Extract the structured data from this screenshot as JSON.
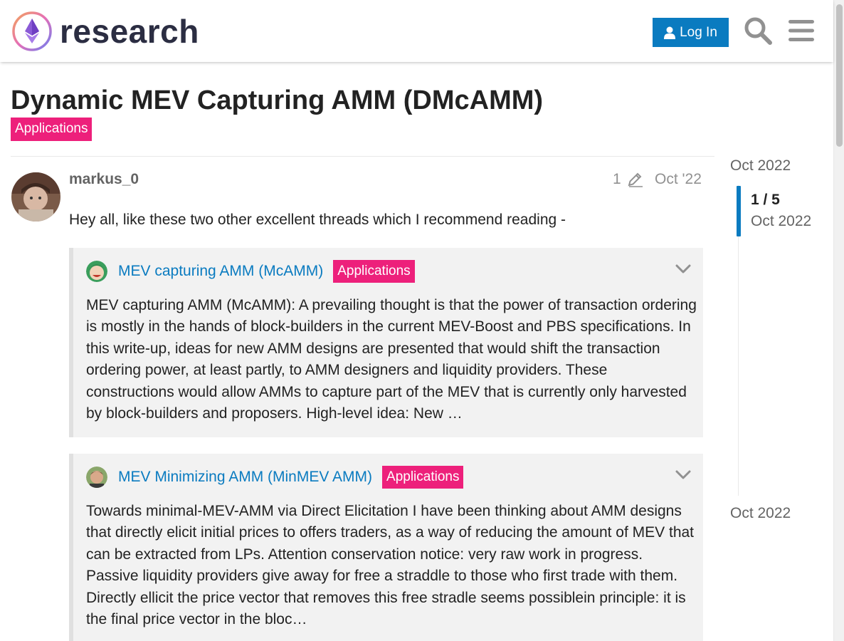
{
  "header": {
    "logo_text": "research",
    "login_label": "Log In"
  },
  "topic": {
    "title": "Dynamic MEV Capturing AMM (DMcAMM)",
    "category": "Applications",
    "category_color": "#ed207b"
  },
  "post": {
    "username": "markus_0",
    "edit_count": "1",
    "date": "Oct '22",
    "intro": "Hey all, like these two other excellent threads which I recommend reading -"
  },
  "oneboxes": [
    {
      "title": "MEV capturing AMM (McAMM)",
      "category": "Applications",
      "excerpt": "MEV capturing AMM (McAMM): A prevailing thought is that the power of transaction ordering is mostly in the hands of block-builders in the current MEV-Boost and PBS specifications. In this write-up, ideas for new AMM designs are presented that would shift the transaction ordering power, at least partly, to AMM designers and liquidity providers. These constructions would allow AMMs to capture part of the MEV that is currently only harvested by block-builders and proposers. High-level idea: New …"
    },
    {
      "title": "MEV Minimizing AMM (MinMEV AMM)",
      "category": "Applications",
      "excerpt": "Towards minimal-MEV-AMM via Direct Elicitation I have been thinking about AMM designs that directly elicit initial prices to offers traders, as a way of reducing the amount of MEV that can be extracted from LPs. Attention conservation notice: very raw work in progress. Passive liquidity providers give away for free a straddle to those who first trade with them. Directly ellicit the price vector that removes this free stradle seems possiblein principle: it is the final price vector in the bloc…"
    }
  ],
  "timeline": {
    "start_date": "Oct 2022",
    "position": "1 / 5",
    "position_date": "Oct 2022",
    "end_date": "Oct 2022"
  },
  "colors": {
    "accent": "#0a7bc0",
    "badge": "#ed207b"
  }
}
